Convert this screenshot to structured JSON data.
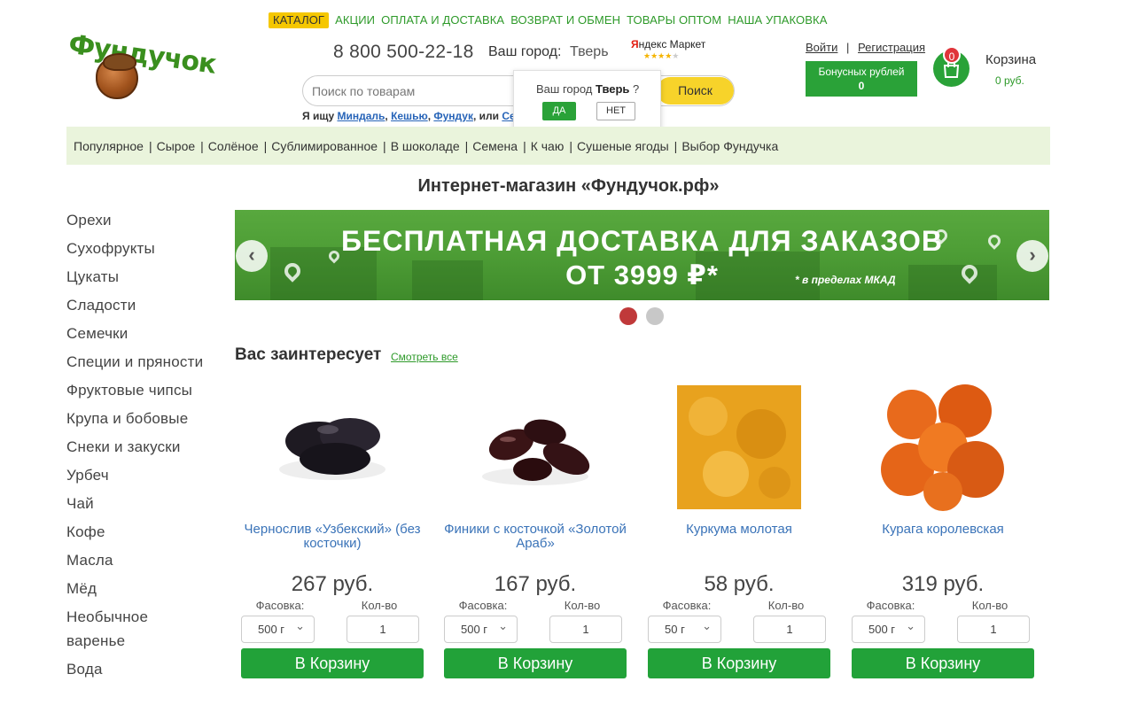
{
  "logo": {
    "text": "Фундучок"
  },
  "top_menu": [
    "КАТАЛОГ",
    "АКЦИИ",
    "ОПЛАТА И ДОСТАВКА",
    "ВОЗВРАТ И ОБМЕН",
    "ТОВАРЫ ОПТОМ",
    "НАША УПАКОВКА"
  ],
  "header": {
    "phone": "8 800 500-22-18",
    "city_label": "Ваш город:",
    "city_value": "Тверь",
    "ym_y": "Я",
    "ym_rest": "ндекс Маркет",
    "ym_stars": "★★★★",
    "ym_star_empty": "★",
    "login": "Войти",
    "auth_sep": "|",
    "register": "Регистрация",
    "bonus_label": "Бонусных рублей",
    "bonus_value": "0",
    "cart_label": "Корзина",
    "cart_count": "0",
    "cart_sum": "0 руб."
  },
  "search": {
    "placeholder": "Поиск по товарам",
    "button": "Поиск",
    "hint_prefix": "Я ищу ",
    "hint_links": [
      "Миндаль",
      "Кешью",
      "Фундук"
    ],
    "hint_sep": ", ",
    "hint_or": ", или ",
    "hint_last": "Семе"
  },
  "city_popup": {
    "question_prefix": "Ваш город ",
    "city": "Тверь",
    "question_suffix": " ?",
    "yes": "ДА",
    "no": "НЕТ"
  },
  "category_bar": [
    "Популярное",
    "Сырое",
    "Солёное",
    "Сублимированное",
    "В шоколаде",
    "Семена",
    "К чаю",
    "Сушеные ягоды",
    "Выбор Фундучка"
  ],
  "category_sep": "|",
  "page_title": "Интернет-магазин «Фундучок.рф»",
  "sidebar": [
    "Орехи",
    "Сухофрукты",
    "Цукаты",
    "Сладости",
    "Семечки",
    "Специи и пряности",
    "Фруктовые чипсы",
    "Крупа и бобовые",
    "Снеки и закуски",
    "Урбеч",
    "Чай",
    "Кофе",
    "Масла",
    "Мёд",
    "Необычное",
    "варенье",
    "Вода"
  ],
  "banner": {
    "line1": "БЕСПЛАТНАЯ ДОСТАВКА ДЛЯ ЗАКАЗОВ",
    "line2": "ОТ 3999 ₽*",
    "note": "* в пределах МКАД",
    "prev": "‹",
    "next": "›",
    "slide_count": 2,
    "active_slide": 1
  },
  "section": {
    "title": "Вас заинтересует",
    "see_all": "Смотреть все"
  },
  "products": [
    {
      "name": "Чернослив «Узбекский» (без косточки)",
      "price": "267 руб.",
      "pack_label": "Фасовка:",
      "qty_label": "Кол-во",
      "pack": "500 г",
      "qty": "1",
      "buy": "В Корзину",
      "color": "#1e1a22"
    },
    {
      "name": "Финики с косточкой «Золотой Араб»",
      "price": "167 руб.",
      "pack_label": "Фасовка:",
      "qty_label": "Кол-во",
      "pack": "500 г",
      "qty": "1",
      "buy": "В Корзину",
      "color": "#3a1416"
    },
    {
      "name": "Куркума молотая",
      "price": "58 руб.",
      "pack_label": "Фасовка:",
      "qty_label": "Кол-во",
      "pack": "50 г",
      "qty": "1",
      "buy": "В Корзину",
      "color": "#e8a21e"
    },
    {
      "name": "Курага королевская",
      "price": "319 руб.",
      "pack_label": "Фасовка:",
      "qty_label": "Кол-во",
      "pack": "500 г",
      "qty": "1",
      "buy": "В Корзину",
      "color": "#e0621a"
    }
  ],
  "colors": {
    "brand_green": "#2aa238",
    "accent_yellow": "#f7d32a",
    "link_blue": "#3a73b8",
    "cat_bg": "#eaf4dc"
  }
}
